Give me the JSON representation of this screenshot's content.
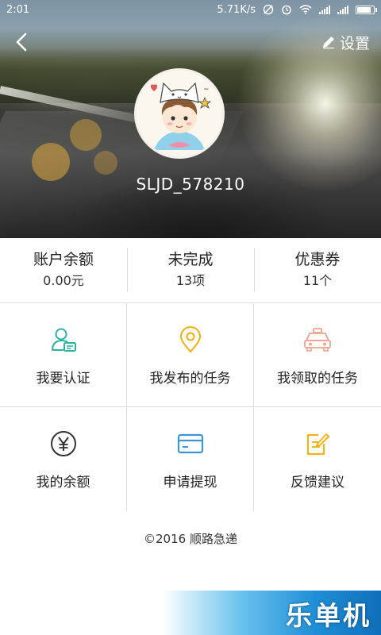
{
  "status_bar": {
    "time": "2:01",
    "net_speed": "5.71K/s"
  },
  "header": {
    "back_icon": "chevron-left-icon",
    "settings_icon": "pencil-icon",
    "settings_label": "设置"
  },
  "profile": {
    "username": "SLJD_578210"
  },
  "stats": [
    {
      "label": "账户余额",
      "value": "0.00元"
    },
    {
      "label": "未完成",
      "value": "13项"
    },
    {
      "label": "优惠券",
      "value": "11个"
    }
  ],
  "menu": [
    {
      "label": "我要认证",
      "icon": "user-card-icon",
      "color": "#2bb3a0"
    },
    {
      "label": "我发布的任务",
      "icon": "location-pin-icon",
      "color": "#f2b41b"
    },
    {
      "label": "我领取的任务",
      "icon": "taxi-icon",
      "color": "#f1a48c"
    },
    {
      "label": "我的余额",
      "icon": "yen-icon",
      "color": "#333333"
    },
    {
      "label": "申请提现",
      "icon": "credit-card-icon",
      "color": "#3a97d4"
    },
    {
      "label": "反馈建议",
      "icon": "edit-note-icon",
      "color": "#f2b41b"
    }
  ],
  "footer": {
    "copyright": "©2016 顺路急递"
  },
  "watermark": {
    "text": "乐单机"
  }
}
